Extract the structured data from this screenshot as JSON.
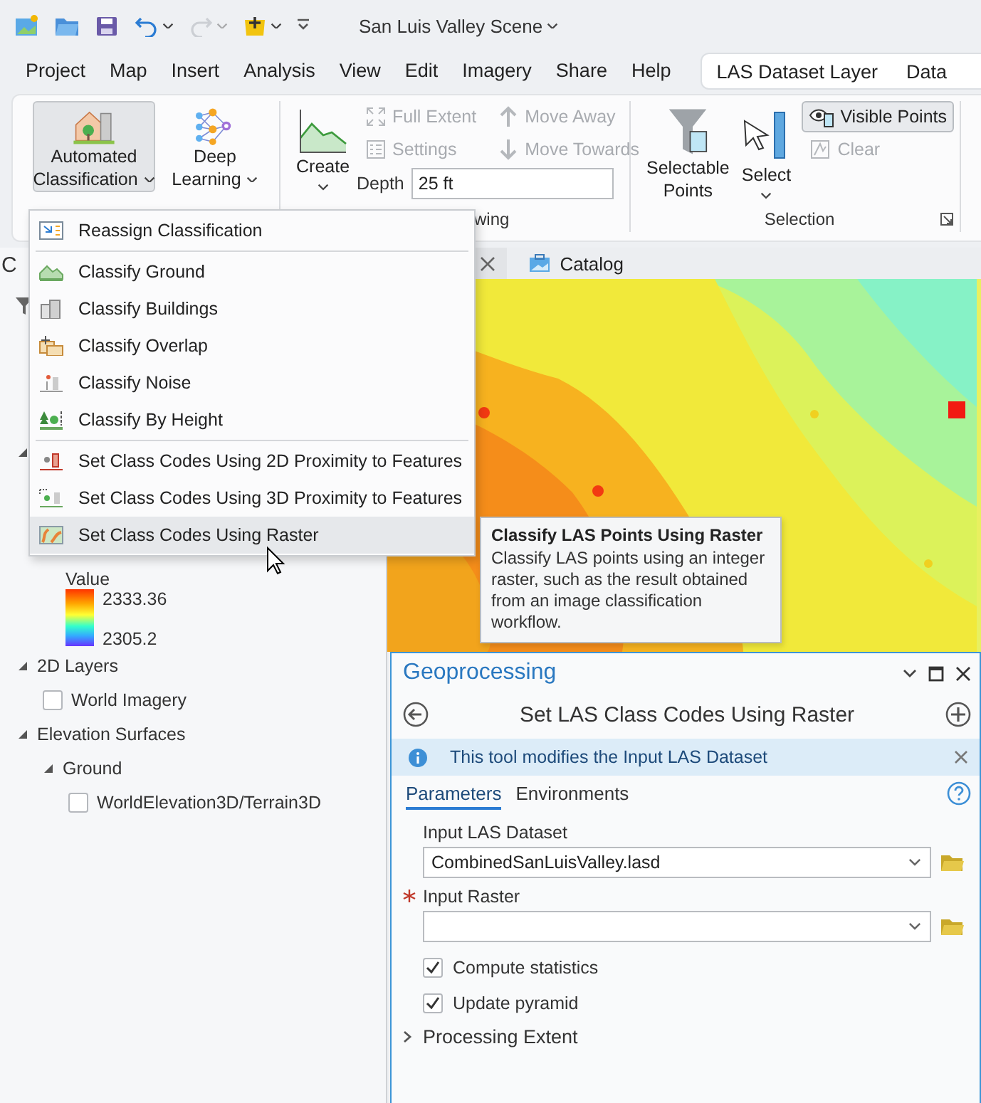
{
  "quick_access": {
    "redo_disabled": true
  },
  "title": "San Luis Valley Scene",
  "menu_tabs": [
    {
      "label": "Project",
      "selected": false
    },
    {
      "label": "Map",
      "selected": false
    },
    {
      "label": "Insert",
      "selected": false
    },
    {
      "label": "Analysis",
      "selected": false
    },
    {
      "label": "View",
      "selected": false
    },
    {
      "label": "Edit",
      "selected": false
    },
    {
      "label": "Imagery",
      "selected": false
    },
    {
      "label": "Share",
      "selected": false
    },
    {
      "label": "Help",
      "selected": false
    }
  ],
  "contextual": {
    "label": "LAS Dataset Layer",
    "tabs": [
      {
        "label": "Data",
        "selected": false
      }
    ]
  },
  "ribbon": {
    "groups": [
      {
        "large": [
          {
            "lines": [
              "Automated",
              "Classification"
            ],
            "dropdown": true,
            "pressed": true
          },
          {
            "lines": [
              "Deep",
              "Learning"
            ],
            "dropdown": true,
            "pressed": false
          }
        ]
      },
      {
        "label": "wing",
        "large": [
          {
            "lines": [
              "Create"
            ],
            "dropdown": true,
            "pressed": false
          }
        ],
        "small": [
          {
            "label": "Full Extent",
            "disabled": true,
            "on": false
          },
          {
            "label": "Settings",
            "disabled": true,
            "on": false
          },
          {
            "label": "Move Away",
            "disabled": true,
            "on": false
          },
          {
            "label": "Move Towards",
            "disabled": true,
            "on": false
          }
        ],
        "input": {
          "label": "Depth",
          "value": "25 ft"
        }
      },
      {
        "label": "Selection",
        "launcher": true,
        "large": [
          {
            "lines": [
              "Selectable",
              "Points"
            ],
            "dropdown": false,
            "pressed": false
          },
          {
            "lines": [
              "Select"
            ],
            "dropdown": true,
            "pressed": false
          }
        ],
        "small": [
          {
            "label": "Visible Points",
            "disabled": false,
            "on": true
          },
          {
            "label": "Clear",
            "disabled": true,
            "on": false
          }
        ]
      }
    ]
  },
  "contents": {
    "title": "C",
    "tree": [
      {
        "expanded": true,
        "legend": {
          "heading": "Value",
          "high": "2333.36",
          "low": "2305.2"
        }
      },
      {
        "label": "2D Layers",
        "expanded": true,
        "children": [
          {
            "label": "World Imagery",
            "checked": false
          }
        ]
      },
      {
        "label": "Elevation Surfaces",
        "expanded": true,
        "children": [
          {
            "label": "Ground",
            "expanded": true,
            "children": [
              {
                "label": "WorldElevation3D/Terrain3D",
                "checked": false
              }
            ]
          }
        ]
      }
    ]
  },
  "doc_tabs": [
    {
      "closable": true
    },
    {
      "label": "Catalog",
      "closable": false
    }
  ],
  "tooltip": {
    "title": "Classify LAS Points Using Raster",
    "body": "Classify LAS points using an integer raster, such as the result obtained from an image classification workflow."
  },
  "dropdown_menu": {
    "sections": [
      [
        {
          "label": "Reassign Classification",
          "hovered": false
        }
      ],
      [
        {
          "label": "Classify Ground",
          "hovered": false
        },
        {
          "label": "Classify Buildings",
          "hovered": false
        },
        {
          "label": "Classify Overlap",
          "hovered": false
        },
        {
          "label": "Classify Noise",
          "hovered": false
        },
        {
          "label": "Classify By Height",
          "hovered": false
        }
      ],
      [
        {
          "label": "Set Class Codes Using 2D Proximity to Features",
          "hovered": false
        },
        {
          "label": "Set Class Codes Using 3D Proximity to Features",
          "hovered": false
        },
        {
          "label": "Set Class Codes Using Raster",
          "hovered": true
        }
      ]
    ]
  },
  "geoprocessing": {
    "pane_title": "Geoprocessing",
    "tool_title": "Set LAS Class Codes Using Raster",
    "info": "This tool modifies the Input LAS Dataset",
    "tabs": [
      {
        "label": "Parameters",
        "selected": true
      },
      {
        "label": "Environments",
        "selected": false
      }
    ],
    "parameters": [
      {
        "kind": "dropdown",
        "label": "Input LAS Dataset",
        "value": "CombinedSanLuisValley.lasd",
        "required": false
      },
      {
        "kind": "dropdown",
        "label": "Input Raster",
        "required": true
      },
      {
        "kind": "checkbox",
        "label": "Compute statistics",
        "checked": true
      },
      {
        "kind": "checkbox",
        "label": "Update pyramid",
        "checked": true
      }
    ],
    "sections": [
      {
        "label": "Processing Extent",
        "expanded": false
      }
    ]
  }
}
